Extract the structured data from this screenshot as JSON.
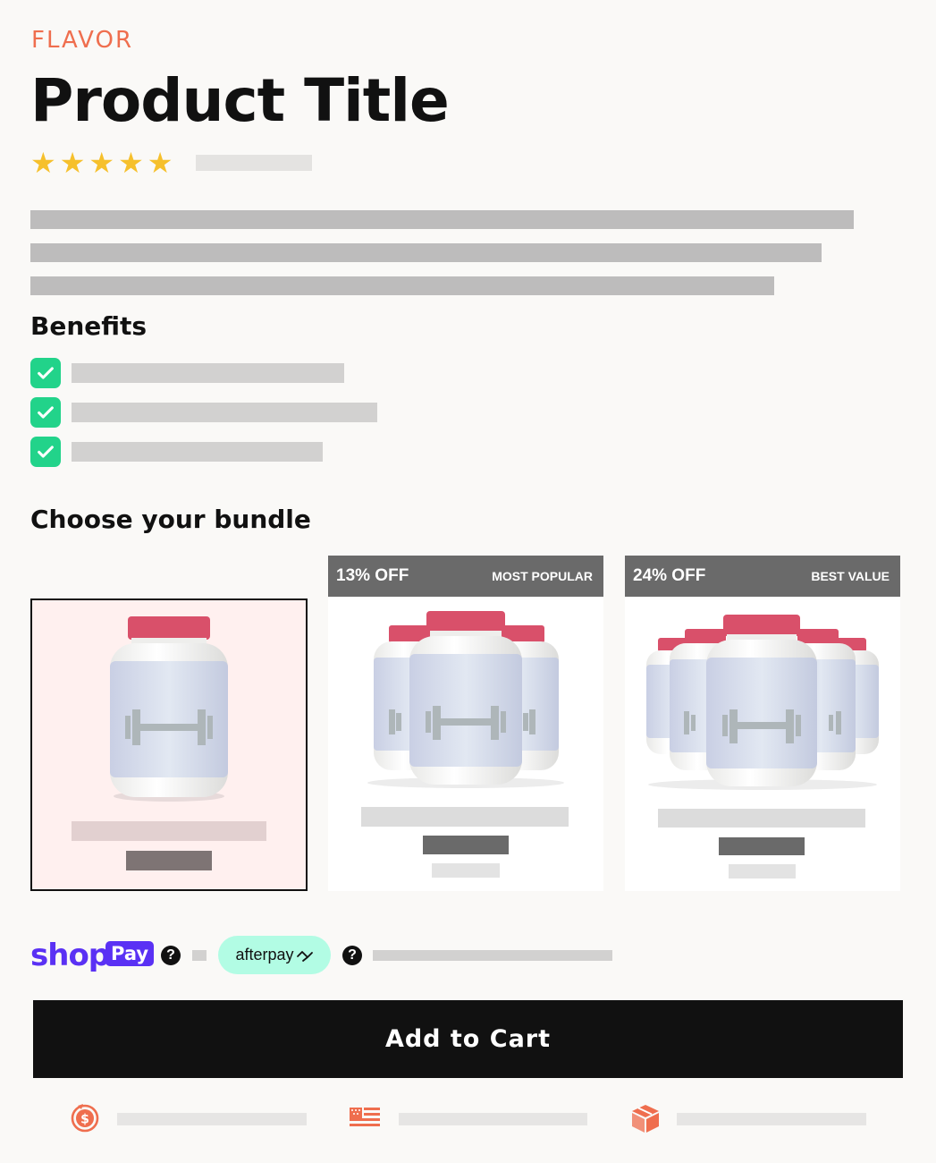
{
  "product": {
    "flavor_label": "FLAVOR",
    "title": "Product Title",
    "rating": 5
  },
  "benefits": {
    "heading": "Benefits",
    "count": 3
  },
  "bundle": {
    "heading": "Choose your bundle",
    "options": [
      {
        "discount": "",
        "tag": "",
        "bottles": 1,
        "selected": true
      },
      {
        "discount": "13% OFF",
        "tag": "MOST POPULAR",
        "bottles": 3,
        "selected": false
      },
      {
        "discount": "24% OFF",
        "tag": "BEST VALUE",
        "bottles": 5,
        "selected": false
      }
    ]
  },
  "payment": {
    "shop_text": "shop",
    "pay_text": "Pay",
    "afterpay_text": "afterpay",
    "help_glyph": "?"
  },
  "cart": {
    "button_label": "Add to Cart"
  },
  "footer": {
    "icons": [
      "money-back-icon",
      "us-flag-icon",
      "shipping-box-icon"
    ]
  },
  "colors": {
    "accent": "#ef6e4e",
    "star": "#f6c02c",
    "check": "#22d38a",
    "shop_pay": "#5a31f4",
    "afterpay": "#b2fce4",
    "jar_cap": "#d9506a"
  }
}
